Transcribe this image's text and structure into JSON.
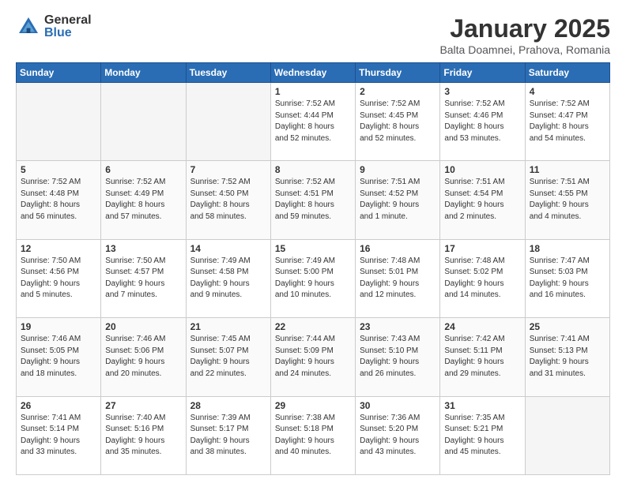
{
  "header": {
    "logo_general": "General",
    "logo_blue": "Blue",
    "month_title": "January 2025",
    "location": "Balta Doamnei, Prahova, Romania"
  },
  "weekdays": [
    "Sunday",
    "Monday",
    "Tuesday",
    "Wednesday",
    "Thursday",
    "Friday",
    "Saturday"
  ],
  "weeks": [
    [
      {
        "day": "",
        "content": ""
      },
      {
        "day": "",
        "content": ""
      },
      {
        "day": "",
        "content": ""
      },
      {
        "day": "1",
        "content": "Sunrise: 7:52 AM\nSunset: 4:44 PM\nDaylight: 8 hours\nand 52 minutes."
      },
      {
        "day": "2",
        "content": "Sunrise: 7:52 AM\nSunset: 4:45 PM\nDaylight: 8 hours\nand 52 minutes."
      },
      {
        "day": "3",
        "content": "Sunrise: 7:52 AM\nSunset: 4:46 PM\nDaylight: 8 hours\nand 53 minutes."
      },
      {
        "day": "4",
        "content": "Sunrise: 7:52 AM\nSunset: 4:47 PM\nDaylight: 8 hours\nand 54 minutes."
      }
    ],
    [
      {
        "day": "5",
        "content": "Sunrise: 7:52 AM\nSunset: 4:48 PM\nDaylight: 8 hours\nand 56 minutes."
      },
      {
        "day": "6",
        "content": "Sunrise: 7:52 AM\nSunset: 4:49 PM\nDaylight: 8 hours\nand 57 minutes."
      },
      {
        "day": "7",
        "content": "Sunrise: 7:52 AM\nSunset: 4:50 PM\nDaylight: 8 hours\nand 58 minutes."
      },
      {
        "day": "8",
        "content": "Sunrise: 7:52 AM\nSunset: 4:51 PM\nDaylight: 8 hours\nand 59 minutes."
      },
      {
        "day": "9",
        "content": "Sunrise: 7:51 AM\nSunset: 4:52 PM\nDaylight: 9 hours\nand 1 minute."
      },
      {
        "day": "10",
        "content": "Sunrise: 7:51 AM\nSunset: 4:54 PM\nDaylight: 9 hours\nand 2 minutes."
      },
      {
        "day": "11",
        "content": "Sunrise: 7:51 AM\nSunset: 4:55 PM\nDaylight: 9 hours\nand 4 minutes."
      }
    ],
    [
      {
        "day": "12",
        "content": "Sunrise: 7:50 AM\nSunset: 4:56 PM\nDaylight: 9 hours\nand 5 minutes."
      },
      {
        "day": "13",
        "content": "Sunrise: 7:50 AM\nSunset: 4:57 PM\nDaylight: 9 hours\nand 7 minutes."
      },
      {
        "day": "14",
        "content": "Sunrise: 7:49 AM\nSunset: 4:58 PM\nDaylight: 9 hours\nand 9 minutes."
      },
      {
        "day": "15",
        "content": "Sunrise: 7:49 AM\nSunset: 5:00 PM\nDaylight: 9 hours\nand 10 minutes."
      },
      {
        "day": "16",
        "content": "Sunrise: 7:48 AM\nSunset: 5:01 PM\nDaylight: 9 hours\nand 12 minutes."
      },
      {
        "day": "17",
        "content": "Sunrise: 7:48 AM\nSunset: 5:02 PM\nDaylight: 9 hours\nand 14 minutes."
      },
      {
        "day": "18",
        "content": "Sunrise: 7:47 AM\nSunset: 5:03 PM\nDaylight: 9 hours\nand 16 minutes."
      }
    ],
    [
      {
        "day": "19",
        "content": "Sunrise: 7:46 AM\nSunset: 5:05 PM\nDaylight: 9 hours\nand 18 minutes."
      },
      {
        "day": "20",
        "content": "Sunrise: 7:46 AM\nSunset: 5:06 PM\nDaylight: 9 hours\nand 20 minutes."
      },
      {
        "day": "21",
        "content": "Sunrise: 7:45 AM\nSunset: 5:07 PM\nDaylight: 9 hours\nand 22 minutes."
      },
      {
        "day": "22",
        "content": "Sunrise: 7:44 AM\nSunset: 5:09 PM\nDaylight: 9 hours\nand 24 minutes."
      },
      {
        "day": "23",
        "content": "Sunrise: 7:43 AM\nSunset: 5:10 PM\nDaylight: 9 hours\nand 26 minutes."
      },
      {
        "day": "24",
        "content": "Sunrise: 7:42 AM\nSunset: 5:11 PM\nDaylight: 9 hours\nand 29 minutes."
      },
      {
        "day": "25",
        "content": "Sunrise: 7:41 AM\nSunset: 5:13 PM\nDaylight: 9 hours\nand 31 minutes."
      }
    ],
    [
      {
        "day": "26",
        "content": "Sunrise: 7:41 AM\nSunset: 5:14 PM\nDaylight: 9 hours\nand 33 minutes."
      },
      {
        "day": "27",
        "content": "Sunrise: 7:40 AM\nSunset: 5:16 PM\nDaylight: 9 hours\nand 35 minutes."
      },
      {
        "day": "28",
        "content": "Sunrise: 7:39 AM\nSunset: 5:17 PM\nDaylight: 9 hours\nand 38 minutes."
      },
      {
        "day": "29",
        "content": "Sunrise: 7:38 AM\nSunset: 5:18 PM\nDaylight: 9 hours\nand 40 minutes."
      },
      {
        "day": "30",
        "content": "Sunrise: 7:36 AM\nSunset: 5:20 PM\nDaylight: 9 hours\nand 43 minutes."
      },
      {
        "day": "31",
        "content": "Sunrise: 7:35 AM\nSunset: 5:21 PM\nDaylight: 9 hours\nand 45 minutes."
      },
      {
        "day": "",
        "content": ""
      }
    ]
  ]
}
